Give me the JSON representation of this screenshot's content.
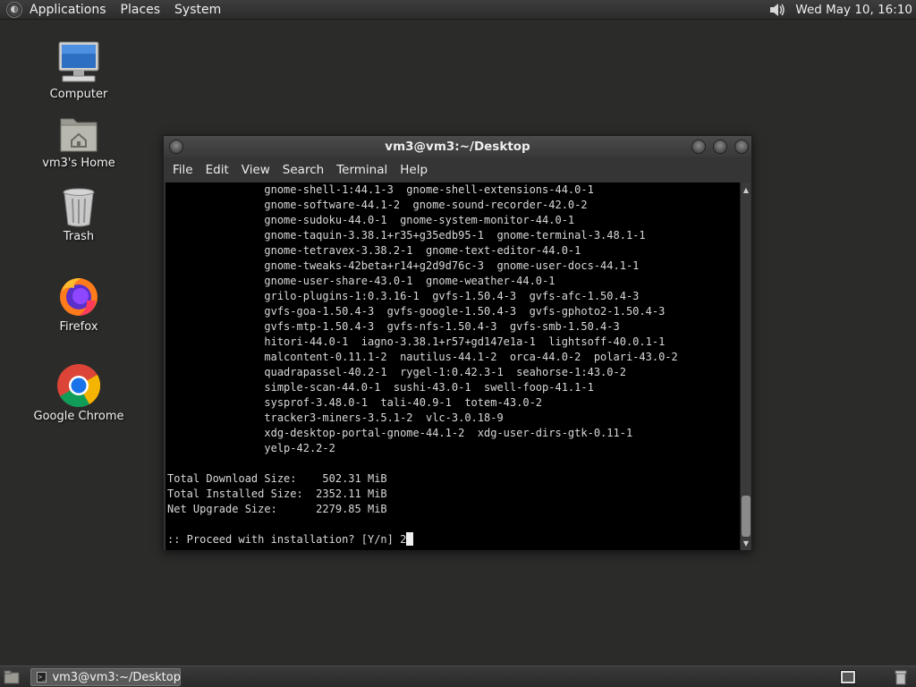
{
  "top_panel": {
    "menus": [
      "Applications",
      "Places",
      "System"
    ],
    "clock": "Wed May 10, 16:10"
  },
  "desktop": {
    "icons": [
      {
        "label": "Computer",
        "icon": "computer-icon"
      },
      {
        "label": "vm3's Home",
        "icon": "home-folder-icon"
      },
      {
        "label": "Trash",
        "icon": "trash-icon"
      },
      {
        "label": "Firefox",
        "icon": "firefox-icon"
      },
      {
        "label": "Google Chrome",
        "icon": "chrome-icon"
      }
    ]
  },
  "terminal": {
    "title": "vm3@vm3:~/Desktop",
    "menu": [
      "File",
      "Edit",
      "View",
      "Search",
      "Terminal",
      "Help"
    ],
    "lines": [
      "               gnome-shell-1:44.1-3  gnome-shell-extensions-44.0-1",
      "               gnome-software-44.1-2  gnome-sound-recorder-42.0-2",
      "               gnome-sudoku-44.0-1  gnome-system-monitor-44.0-1",
      "               gnome-taquin-3.38.1+r35+g35edb95-1  gnome-terminal-3.48.1-1",
      "               gnome-tetravex-3.38.2-1  gnome-text-editor-44.0-1",
      "               gnome-tweaks-42beta+r14+g2d9d76c-3  gnome-user-docs-44.1-1",
      "               gnome-user-share-43.0-1  gnome-weather-44.0-1",
      "               grilo-plugins-1:0.3.16-1  gvfs-1.50.4-3  gvfs-afc-1.50.4-3",
      "               gvfs-goa-1.50.4-3  gvfs-google-1.50.4-3  gvfs-gphoto2-1.50.4-3",
      "               gvfs-mtp-1.50.4-3  gvfs-nfs-1.50.4-3  gvfs-smb-1.50.4-3",
      "               hitori-44.0-1  iagno-3.38.1+r57+gd147e1a-1  lightsoff-40.0.1-1",
      "               malcontent-0.11.1-2  nautilus-44.1-2  orca-44.0-2  polari-43.0-2",
      "               quadrapassel-40.2-1  rygel-1:0.42.3-1  seahorse-1:43.0-2",
      "               simple-scan-44.0-1  sushi-43.0-1  swell-foop-41.1-1",
      "               sysprof-3.48.0-1  tali-40.9-1  totem-43.0-2",
      "               tracker3-miners-3.5.1-2  vlc-3.0.18-9",
      "               xdg-desktop-portal-gnome-44.1-2  xdg-user-dirs-gtk-0.11-1",
      "               yelp-42.2-2",
      "",
      "Total Download Size:    502.31 MiB",
      "Total Installed Size:  2352.11 MiB",
      "Net Upgrade Size:      2279.85 MiB",
      "",
      ":: Proceed with installation? [Y/n] 2"
    ]
  },
  "taskbar": {
    "task_label": "vm3@vm3:~/Desktop"
  }
}
